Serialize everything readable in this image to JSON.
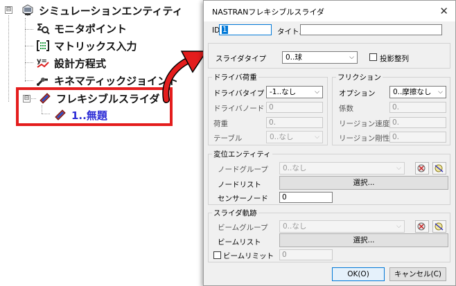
{
  "tree": {
    "items": [
      {
        "label": "シミュレーションエンティティ",
        "icon": "simulation-entity-icon"
      },
      {
        "label": "モニタポイント",
        "icon": "monitor-point-icon"
      },
      {
        "label": "マトリックス入力",
        "icon": "matrix-input-icon"
      },
      {
        "label": "設計方程式",
        "icon": "design-equation-icon"
      },
      {
        "label": "キネマティックジョイント",
        "icon": "kinematic-joint-icon"
      },
      {
        "label": "フレキシブルスライダ",
        "icon": "flexible-slider-icon"
      },
      {
        "label": "1..無題",
        "icon": "flexible-slider-icon"
      }
    ],
    "expander_collapsed": "⊟",
    "highlight_color": "#e41d1d",
    "child_color": "#2b2bd6"
  },
  "dialog": {
    "title": "NASTRANフレキシブルスライダ",
    "close": "✕",
    "id_label": "ID",
    "id_value": "1",
    "title_label": "タイトル",
    "title_value": "",
    "slider_type_label": "スライダタイプ",
    "slider_type_value": "0..球",
    "projection_align_label": "投影整列",
    "driver_load": {
      "group_title": "ドライバ荷重",
      "driver_type_label": "ドライバタイプ",
      "driver_type_value": "-1..なし",
      "driver_node_label": "ドライバノード",
      "driver_node_value": "0",
      "load_label": "荷重",
      "load_value": "0.",
      "table_label": "テーブル",
      "table_value": "0..なし"
    },
    "friction": {
      "group_title": "フリクション",
      "option_label": "オプション",
      "option_value": "0..摩擦なし",
      "coef_label": "係数",
      "coef_value": "0.",
      "region_speed_label": "リージョン速度",
      "region_speed_value": "0.",
      "region_stiffness_label": "リージョン剛性",
      "region_stiffness_value": "0."
    },
    "displacement_entity": {
      "group_title": "変位エンティティ",
      "node_group_label": "ノードグループ",
      "node_group_value": "0..なし",
      "node_list_label": "ノードリスト",
      "node_list_button": "選択...",
      "sensor_node_label": "センサーノード",
      "sensor_node_value": "0"
    },
    "slider_track": {
      "group_title": "スライダ軌跡",
      "beam_group_label": "ビームグループ",
      "beam_group_value": "0..なし",
      "beam_list_label": "ビームリスト",
      "beam_list_button": "選択...",
      "beam_limit_label": "ビームリミット",
      "beam_limit_value": "0"
    },
    "ok_label": "OK(O)",
    "cancel_label": "キャンセル(C)"
  },
  "arrow_color": "#e41d1d"
}
